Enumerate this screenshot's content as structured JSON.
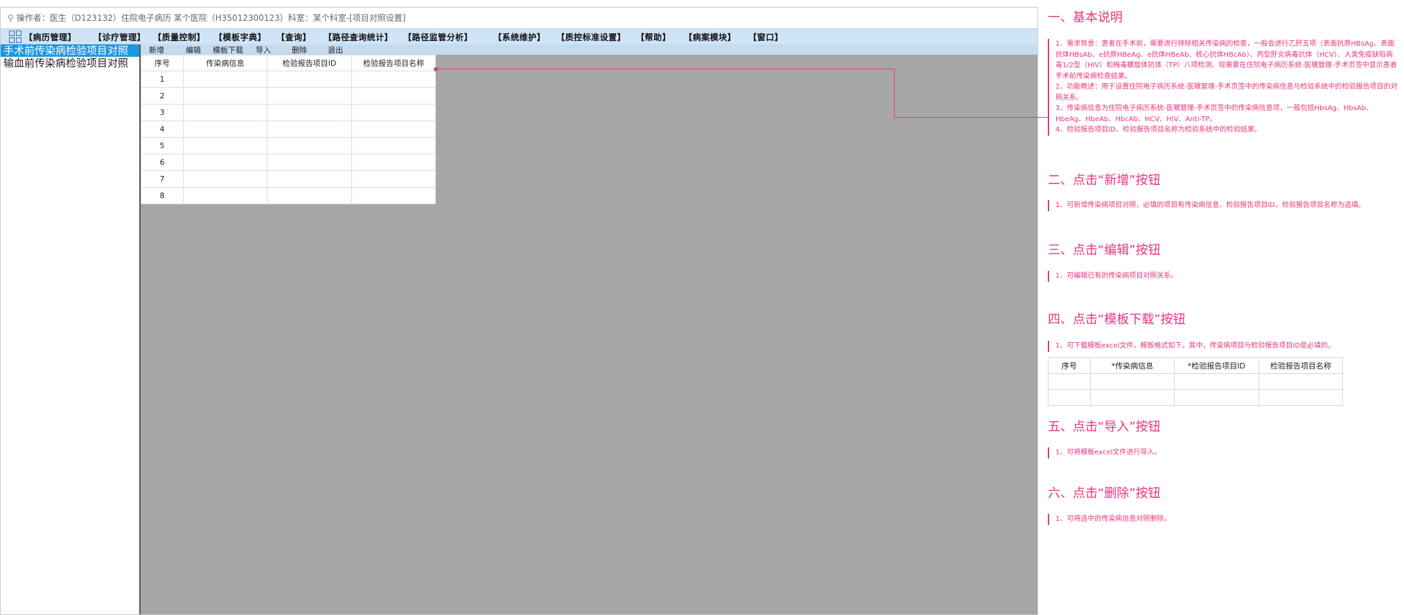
{
  "window": {
    "user_icon": "user-icon",
    "status": "操作者：医生（D123132）住院电子病历 某个医院（H35012300123）科室：某个科室-[项目对照设置]"
  },
  "menu": {
    "icon": "grid-icon",
    "items": [
      "【病历管理】",
      "【诊疗管理】",
      "【质量控制】",
      "【模板字典】",
      "【查询】",
      "【路径查询统计】",
      "【路径监管分析】",
      "【系统维护】",
      "【质控标准设置】",
      "【帮助】",
      "【病案模块】",
      "【窗口】"
    ]
  },
  "left_panel": {
    "items": [
      "手术前传染病检验项目对照",
      "输血前传染病检验项目对照"
    ]
  },
  "toolbar": {
    "add": "新增",
    "edit": "编辑",
    "template_download": "模板下载",
    "import": "导入",
    "delete": "删除",
    "exit": "退出"
  },
  "grid": {
    "columns": [
      "序号",
      "传染病信息",
      "检验报告项目ID",
      "检验报告项目名称"
    ],
    "rows": [
      "1",
      "2",
      "3",
      "4",
      "5",
      "6",
      "7",
      "8"
    ]
  },
  "doc": {
    "s1_title": "一、基本说明",
    "s1_lines": [
      "1、需求背景：患者在手术前，需要进行排除相关传染病的检查，一般会进行乙肝五项（表面抗原HBsAg、表面抗体HBsAb、e抗原HBeAg、e抗体HBeAb、核心抗体HBcAb）、丙型肝炎病毒抗体（HCV）、人类免疫缺陷病毒1/2型（HIV）和梅毒螺旋体抗体（TP）八项检测。现需要在住院电子病历系统-医嘱管理-手术页签中显示患者手术前传染病检查结果。",
      "2、功能概述：用于设置住院电子病历系统-医嘱管理-手术页签中的传染病信息与检验系统中的检验报告项目的对照关系。",
      "3、传染病信息为住院电子病历系统-医嘱管理-手术页签中的传染病信息项，一般包括HbsAg、HbsAb、HbeAg、HbeAb、HbcAb、HCV、HIV、Anti-TP。",
      "4、检验报告项目ID、检验报告项目名称为检验系统中的检验结果。"
    ],
    "s2_title": "二、点击“新增”按钮",
    "s2_text": "1、可新增传染病项目对照，必填的项目有传染病信息、检验报告项目ID，检验报告项目名称为选填。",
    "s3_title": "三、点击“编辑”按钮",
    "s3_text": "1、可编辑已有的传染病项目对照关系。",
    "s4_title": "四、点击“模板下载”按钮",
    "s4_text": "1、可下载模板excel文件，模板格式如下，其中，传染病项目与检验报告项目ID是必填的。",
    "s4_table": [
      "序号",
      "*传染病信息",
      "*检验报告项目ID",
      "检验报告项目名称"
    ],
    "s5_title": "五、点击“导入”按钮",
    "s5_text": "1、可将模板excel文件进行导入。",
    "s6_title": "六、点击“删除”按钮",
    "s6_text": "1、可将选中的传染病信息对照删除。"
  },
  "colors": {
    "accent": "#e9357f",
    "selected": "#1b98e0",
    "menubar": "#cfe4f6",
    "workspace": "#a6a6a6"
  }
}
